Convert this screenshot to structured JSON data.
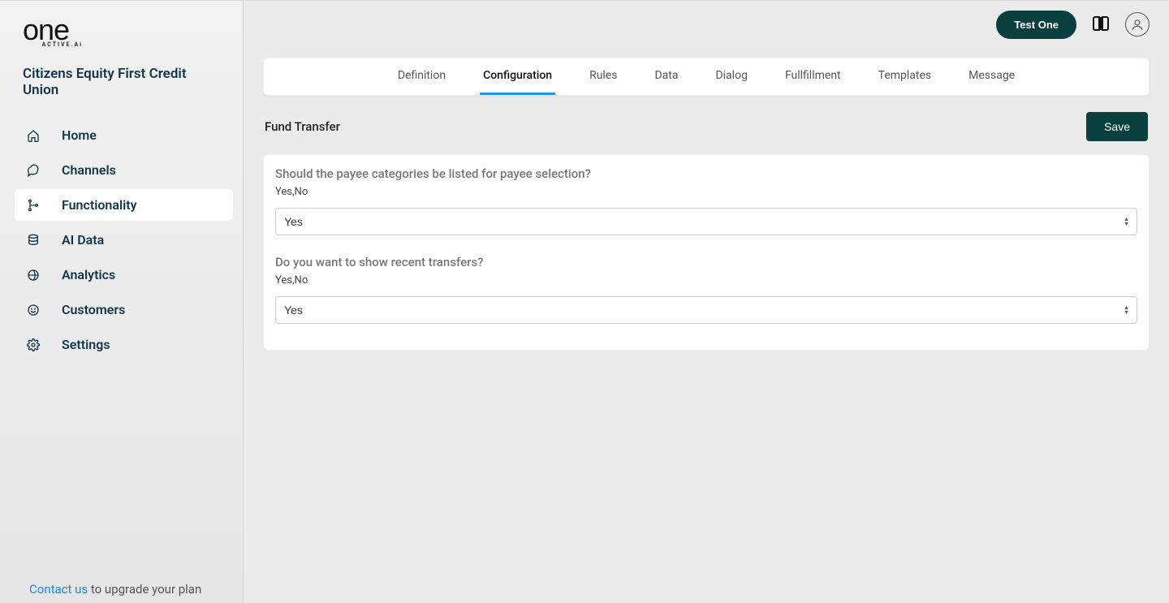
{
  "brand": {
    "main": "one",
    "sub": "ACTIVE.Ai"
  },
  "org": "Citizens Equity First Credit Union",
  "sidebar": {
    "items": [
      {
        "label": "Home",
        "icon": "home-icon",
        "active": false
      },
      {
        "label": "Channels",
        "icon": "chat-icon",
        "active": false
      },
      {
        "label": "Functionality",
        "icon": "tree-icon",
        "active": true
      },
      {
        "label": "AI Data",
        "icon": "database-icon",
        "active": false
      },
      {
        "label": "Analytics",
        "icon": "globe-icon",
        "active": false
      },
      {
        "label": "Customers",
        "icon": "smiley-icon",
        "active": false
      },
      {
        "label": "Settings",
        "icon": "gear-icon",
        "active": false
      }
    ],
    "footer": {
      "link": "Contact us",
      "rest": " to upgrade your plan"
    }
  },
  "topbar": {
    "test_button": "Test One"
  },
  "tabs": [
    {
      "label": "Definition",
      "active": false
    },
    {
      "label": "Configuration",
      "active": true
    },
    {
      "label": "Rules",
      "active": false
    },
    {
      "label": "Data",
      "active": false
    },
    {
      "label": "Dialog",
      "active": false
    },
    {
      "label": "Fullfillment",
      "active": false
    },
    {
      "label": "Templates",
      "active": false
    },
    {
      "label": "Message",
      "active": false
    }
  ],
  "section": {
    "title": "Fund Transfer",
    "save": "Save"
  },
  "form": [
    {
      "question": "Should the payee categories be listed for payee selection?",
      "hint": "Yes,No",
      "value": "Yes",
      "options": [
        "Yes",
        "No"
      ]
    },
    {
      "question": "Do you want to show recent transfers?",
      "hint": "Yes,No",
      "value": "Yes",
      "options": [
        "Yes",
        "No"
      ]
    }
  ]
}
